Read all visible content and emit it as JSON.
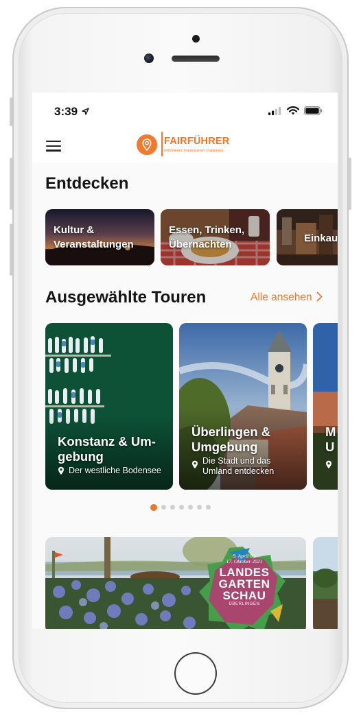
{
  "status": {
    "time": "3:39"
  },
  "header": {
    "logo_name": "FAIRFÜHRER",
    "logo_tagline": "Informieren. Interessieren. Inspirieren."
  },
  "discover": {
    "title": "Entdecken",
    "categories": [
      {
        "label_line1": "Kultur &",
        "label_line2": "Veranstaltungen"
      },
      {
        "label_line1": "Essen, Trinken,",
        "label_line2": "Übernachten"
      },
      {
        "label_line1": "Einkau",
        "label_line2": ""
      }
    ]
  },
  "tours": {
    "title": "Ausgewählte Touren",
    "see_all": "Alle ansehen",
    "items": [
      {
        "title_line1": "Konstanz & Um-",
        "title_line2": "gebung",
        "subtitle_line1": "Der westliche Bodensee",
        "subtitle_line2": ""
      },
      {
        "title_line1": "Überlingen &",
        "title_line2": "Umgebung",
        "subtitle_line1": "Die Stadt und das",
        "subtitle_line2": "Umland entdecken"
      },
      {
        "title_line1": "M",
        "title_line2": "U",
        "subtitle_line1": "",
        "subtitle_line2": ""
      }
    ],
    "pagination": {
      "count": 7,
      "active": 0
    }
  },
  "banner": {
    "badge_date_line1": "9. April bis",
    "badge_date_line2": "17. Oktober 2021",
    "badge_line1": "LANDES",
    "badge_line2": "GARTEN",
    "badge_line3": "SCHAU",
    "badge_place": "ÜBERLINGEN"
  },
  "colors": {
    "accent": "#ee7626",
    "text": "#151515",
    "background": "#fafafa"
  }
}
